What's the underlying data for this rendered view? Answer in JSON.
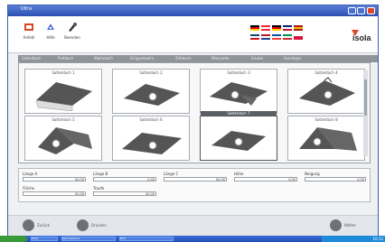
{
  "window": {
    "title": "Ultra"
  },
  "toolbar": [
    {
      "label": "Anfahl",
      "icon": "settings-icon"
    },
    {
      "label": "Hilfe",
      "icon": "help-icon"
    },
    {
      "label": "Beenden",
      "icon": "exit-icon"
    }
  ],
  "flags": [
    {
      "lang": "de",
      "colors": [
        "#000000",
        "#dd0000",
        "#ffce00"
      ]
    },
    {
      "lang": "at",
      "colors": [
        "#ed2939",
        "#ffffff",
        "#ed2939"
      ]
    },
    {
      "lang": "de2",
      "colors": [
        "#000000",
        "#dd0000",
        "#ffce00"
      ]
    },
    {
      "lang": "en",
      "colors": [
        "#012169",
        "#ffffff",
        "#c8102e"
      ]
    },
    {
      "lang": "es",
      "colors": [
        "#aa151b",
        "#f1bf00",
        "#aa151b"
      ]
    },
    {
      "lang": "cs",
      "colors": [
        "#11457e",
        "#ffffff",
        "#d7141a"
      ]
    },
    {
      "lang": "nl",
      "colors": [
        "#ae1c28",
        "#ffffff",
        "#21468b"
      ]
    },
    {
      "lang": "fr",
      "colors": [
        "#0055a4",
        "#ffffff",
        "#ef4135"
      ]
    },
    {
      "lang": "it",
      "colors": [
        "#009246",
        "#ffffff",
        "#ce2b37"
      ]
    },
    {
      "lang": "pl",
      "colors": [
        "#ffffff",
        "#dc143c",
        "#dc143c"
      ]
    }
  ],
  "logo": {
    "text": "isola",
    "accent": "#d9472b"
  },
  "tabs": [
    "Satteldach",
    "Pultdach",
    "Walmdach",
    "Krüppelwalm",
    "Zeltdach",
    "Mansarde",
    "Gaube",
    "Sonstiges"
  ],
  "cards": [
    {
      "label": "Satteldach 1",
      "selected": false
    },
    {
      "label": "Satteldach 2",
      "selected": false
    },
    {
      "label": "Satteldach 3",
      "selected": false
    },
    {
      "label": "Satteldach 4",
      "selected": false
    },
    {
      "label": "Satteldach 5",
      "selected": false
    },
    {
      "label": "Satteldach 6",
      "selected": false
    },
    {
      "label": "Satteldach 7",
      "selected": true
    },
    {
      "label": "Satteldach 8",
      "selected": false
    }
  ],
  "fields": {
    "row1": [
      {
        "label": "Länge A",
        "value": "00,00"
      },
      {
        "label": "Länge B",
        "value": "0,00"
      },
      {
        "label": "Länge C",
        "value": "00,00"
      },
      {
        "label": "Höhe",
        "value": "0,00"
      },
      {
        "label": "Neigung",
        "value": "0,00"
      }
    ],
    "row2": [
      {
        "label": "Fläche",
        "value": "00,00"
      },
      {
        "label": "Traufe",
        "value": "00,00"
      }
    ]
  },
  "bottom": {
    "back": "Zurück",
    "print": "Drucken",
    "next": "Weiter"
  },
  "taskbar": {
    "tasks": [
      "Ultra",
      "Dachrechner",
      "Bild"
    ],
    "clock": "10:12"
  }
}
